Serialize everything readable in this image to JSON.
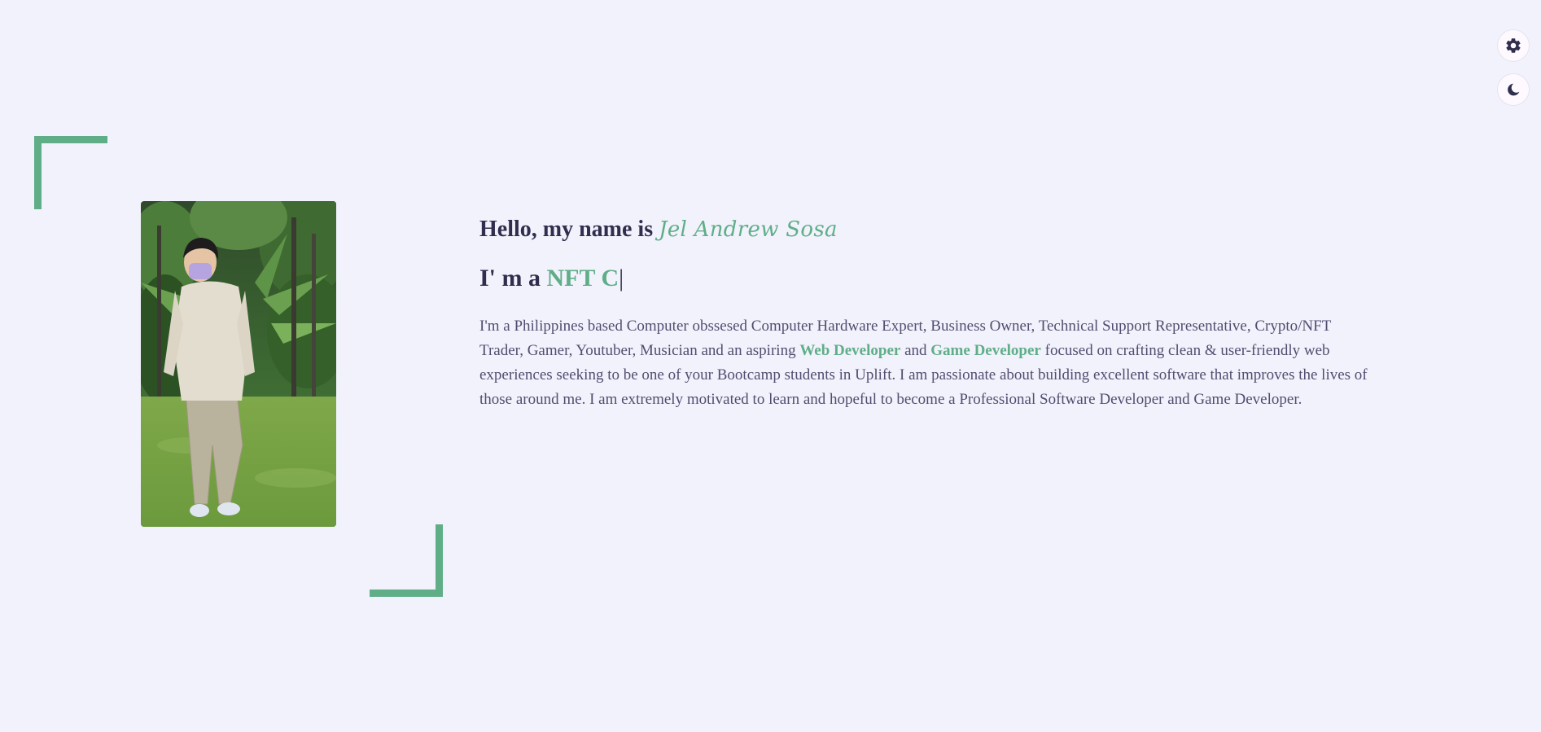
{
  "hero": {
    "greeting": "Hello, my name is ",
    "name": "Jel Andrew Sosa",
    "role_prefix": "I' m a ",
    "role_typed": "NFT C",
    "caret": "|",
    "description": {
      "part1": "I'm a Philippines based Computer obssesed Computer Hardware Expert, Business Owner, Technical Support Representative, Crypto/NFT Trader, Gamer, Youtuber, Musician and an aspiring ",
      "highlight1": "Web Developer",
      "part2": " and ",
      "highlight2": "Game Developer",
      "part3": " focused on crafting clean & user-friendly web experiences seeking to be one of your Bootcamp students in Uplift. I am passionate about building excellent software that improves the lives of those around me. I am extremely motivated to learn and hopeful to become a Professional Software Developer and Game Developer."
    }
  },
  "controls": {
    "settings_icon": "gear-icon",
    "theme_icon": "moon-icon"
  },
  "colors": {
    "accent": "#5fae88",
    "background": "#f2f2fc",
    "text": "#302e4d"
  }
}
